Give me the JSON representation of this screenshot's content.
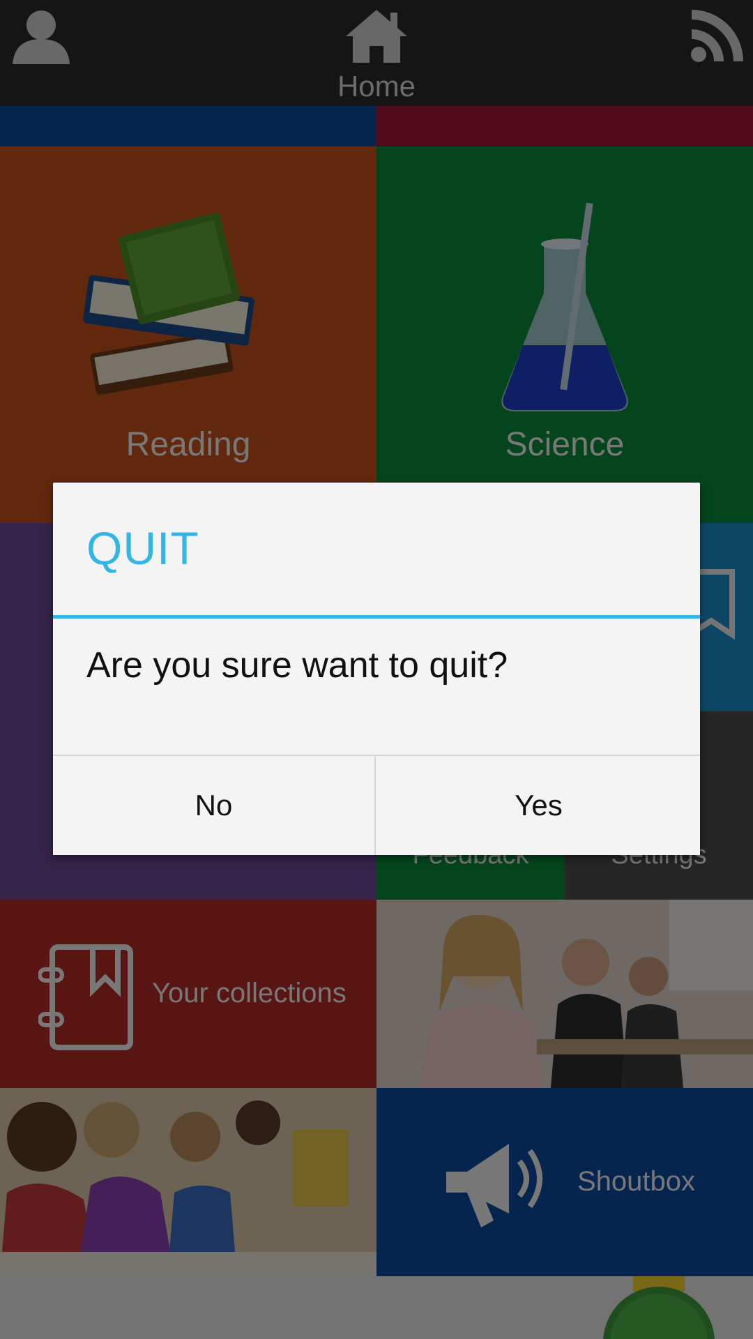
{
  "header": {
    "title": "Home",
    "left_icon": "profile-icon",
    "center_icon": "home-icon",
    "right_icon": "rss-icon"
  },
  "tiles": {
    "reading": {
      "label": "Reading",
      "icon": "books-icon"
    },
    "science": {
      "label": "Science",
      "icon": "flask-icon"
    },
    "feedback": {
      "label": "Feedback"
    },
    "settings": {
      "label": "Settings"
    },
    "collections": {
      "label": "Your collections",
      "icon": "notebook-icon"
    },
    "shoutbox": {
      "label": "Shoutbox",
      "icon": "megaphone-icon"
    }
  },
  "dialog": {
    "title": "QUIT",
    "message": "Are you sure want to quit?",
    "no_label": "No",
    "yes_label": "Yes"
  },
  "colors": {
    "accent": "#33b5e5",
    "reading": "#c4501a",
    "science": "#0b8a3a",
    "purple": "#6d4793",
    "blue": "#1a8cc8",
    "collections": "#b22a22",
    "shoutbox": "#0b4b9c"
  }
}
